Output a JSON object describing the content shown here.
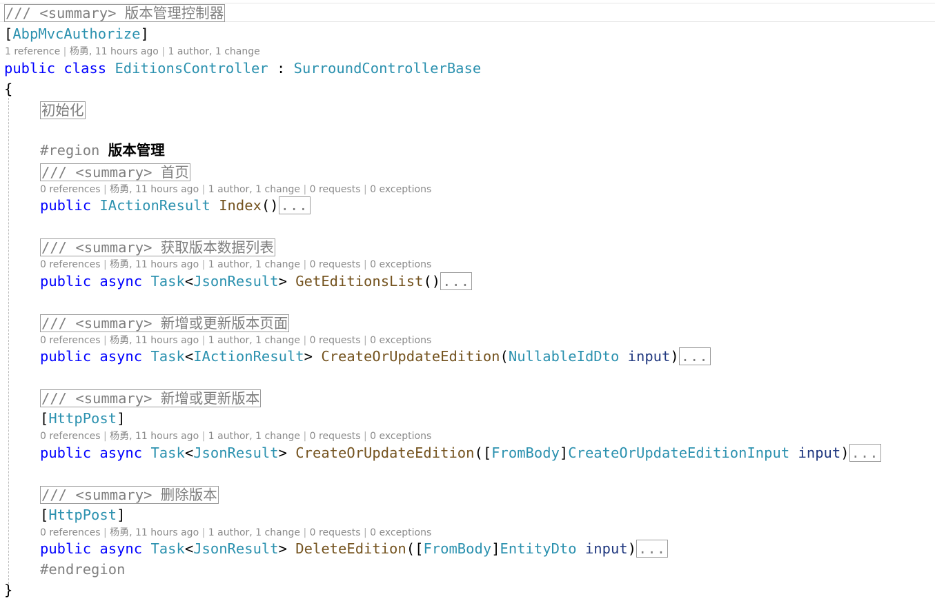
{
  "class_summary": "/// <summary> 版本管理控制器",
  "class_attribute": "AbpMvcAuthorize",
  "class_lens": [
    "1 reference",
    "杨勇, 11 hours ago",
    "1 author, 1 change"
  ],
  "class_decl": {
    "kw_public": "public",
    "kw_class": "class",
    "name": "EditionsController",
    "colon": ":",
    "base": "SurroundControllerBase"
  },
  "open_brace": "{",
  "close_brace": "}",
  "init_region": "初始化",
  "region_directive": "#region",
  "region_name": "版本管理",
  "endregion_directive": "#endregion",
  "method_lens": [
    "0 references",
    "杨勇, 11 hours ago",
    "1 author, 1 change",
    "0 requests",
    "0 exceptions"
  ],
  "collapsed_body": "...",
  "methods": [
    {
      "summary": "/// <summary> 首页",
      "kw_public": "public",
      "kw_async": "",
      "return_type": "IActionResult",
      "name": "Index",
      "open_paren": "(",
      "close_paren": ")"
    },
    {
      "summary": "/// <summary> 获取版本数据列表",
      "kw_public": "public",
      "kw_async": "async",
      "return_generic": "Task",
      "return_arg": "JsonResult",
      "name": "GetEditionsList",
      "open_paren": "(",
      "close_paren": ")"
    },
    {
      "summary": "/// <summary> 新增或更新版本页面",
      "kw_public": "public",
      "kw_async": "async",
      "return_generic": "Task",
      "return_arg": "IActionResult",
      "name": "CreateOrUpdateEdition",
      "param_type": "NullableIdDto",
      "param_name": "input"
    },
    {
      "summary": "/// <summary> 新增或更新版本",
      "attribute": "HttpPost",
      "kw_public": "public",
      "kw_async": "async",
      "return_generic": "Task",
      "return_arg": "JsonResult",
      "name": "CreateOrUpdateEdition",
      "param_attr": "FromBody",
      "param_type": "CreateOrUpdateEditionInput",
      "param_name": "input"
    },
    {
      "summary": "/// <summary> 删除版本",
      "attribute": "HttpPost",
      "kw_public": "public",
      "kw_async": "async",
      "return_generic": "Task",
      "return_arg": "JsonResult",
      "name": "DeleteEdition",
      "param_attr": "FromBody",
      "param_type": "EntityDto",
      "param_name": "input"
    }
  ]
}
